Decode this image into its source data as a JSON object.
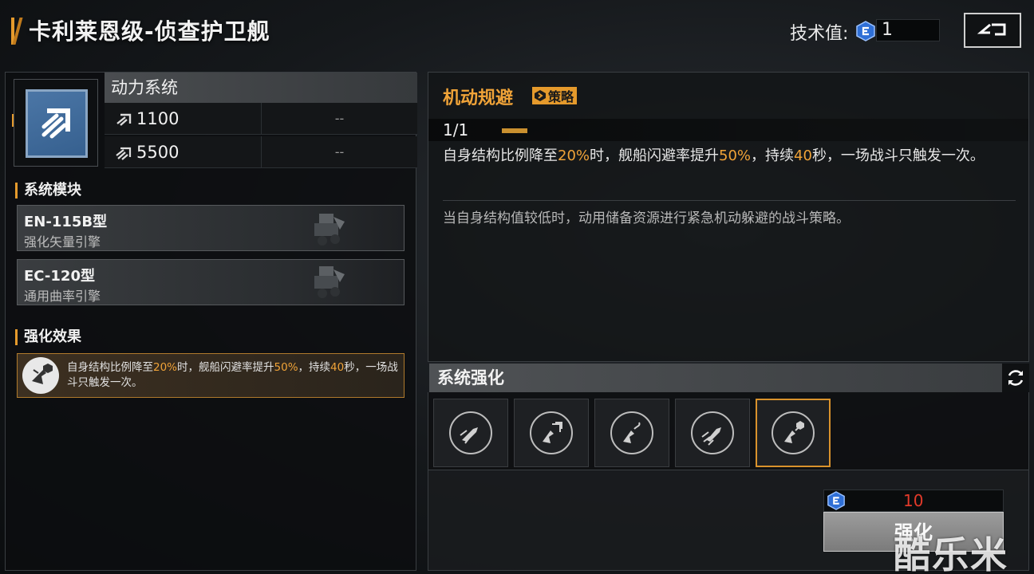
{
  "header": {
    "title": "卡利莱恩级-侦查护卫舰",
    "tech_label": "技术值:",
    "tech_value": "1"
  },
  "system": {
    "name": "动力系统",
    "stats": [
      {
        "icon": "speed-icon",
        "value": "1100",
        "extra": "--"
      },
      {
        "icon": "boost-speed-icon",
        "value": "5500",
        "extra": "--"
      }
    ],
    "icon": "engine-system-icon",
    "icon_color": "#4b76a6"
  },
  "modules_section": {
    "title": "系统模块",
    "items": [
      {
        "title": "EN-115B型",
        "subtitle": "强化矢量引擎"
      },
      {
        "title": "EC-120型",
        "subtitle": "通用曲率引擎"
      }
    ]
  },
  "effects_section": {
    "title": "强化效果",
    "text_pre": "自身结构比例降至",
    "hl1": "20%",
    "text_mid1": "时，舰船闪避率提升",
    "hl2": "50%",
    "text_mid2": "，持续",
    "hl3": "40",
    "text_post": "秒，一场战斗只触发一次。"
  },
  "skill": {
    "name": "机动规避",
    "badge": "策略",
    "level": "1/1",
    "level_fraction": 1.0,
    "desc_pre": "自身结构比例降至",
    "hl1": "20%",
    "desc_mid1": "时，舰船闪避率提升",
    "hl2": "50%",
    "desc_mid2": "，持续",
    "hl3": "40",
    "desc_post": "秒，一场战斗只触发一次。",
    "lore": "当自身结构值较低时，动用储备资源进行紧急机动躲避的战斗策略。"
  },
  "enhance": {
    "title": "系统强化",
    "slots": [
      {
        "icon": "jet-evade-icon",
        "selected": false
      },
      {
        "icon": "jet-shield-icon",
        "selected": false
      },
      {
        "icon": "jet-swerve-icon",
        "selected": false
      },
      {
        "icon": "jet-speed-icon",
        "selected": false
      },
      {
        "icon": "jet-strategy-icon",
        "selected": true
      }
    ],
    "cost": "10",
    "button_label": "强化"
  },
  "watermark": "酷乐米",
  "colors": {
    "accent": "#e59a2c",
    "highlight": "#f0a338",
    "cost": "#e23a2a"
  }
}
